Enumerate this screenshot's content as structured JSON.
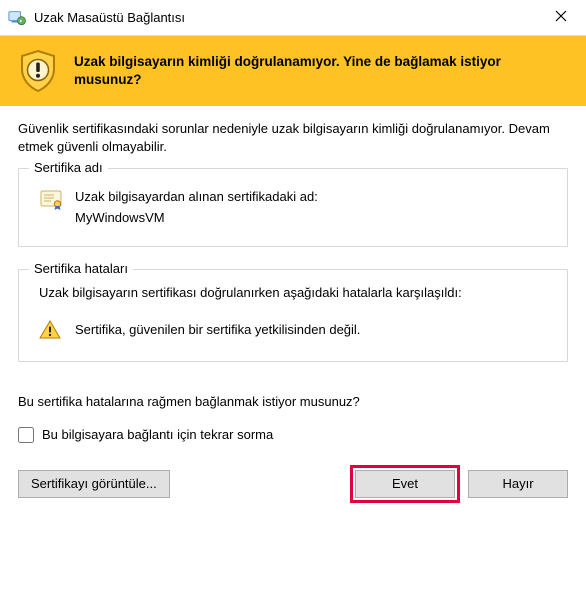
{
  "titlebar": {
    "title": "Uzak Masaüstü Bağlantısı"
  },
  "banner": {
    "text": "Uzak bilgisayarın kimliği doğrulanamıyor. Yine de bağlamak istiyor musunuz?"
  },
  "intro": "Güvenlik sertifikasındaki sorunlar nedeniyle uzak bilgisayarın kimliği doğrulanamıyor. Devam etmek güvenli olmayabilir.",
  "cert_name_group": {
    "title": "Sertifika adı",
    "label": "Uzak bilgisayardan alınan sertifikadaki ad:",
    "value": "MyWindowsVM"
  },
  "cert_errors_group": {
    "title": "Sertifika hataları",
    "intro": "Uzak bilgisayarın sertifikası doğrulanırken aşağıdaki hatalarla karşılaşıldı:",
    "error": "Sertifika, güvenilen bir sertifika yetkilisinden değil."
  },
  "question": "Bu sertifika hatalarına rağmen bağlanmak istiyor musunuz?",
  "checkbox_label": "Bu bilgisayara bağlantı için tekrar sorma",
  "buttons": {
    "view_cert": "Sertifikayı görüntüle...",
    "yes": "Evet",
    "no": "Hayır"
  }
}
